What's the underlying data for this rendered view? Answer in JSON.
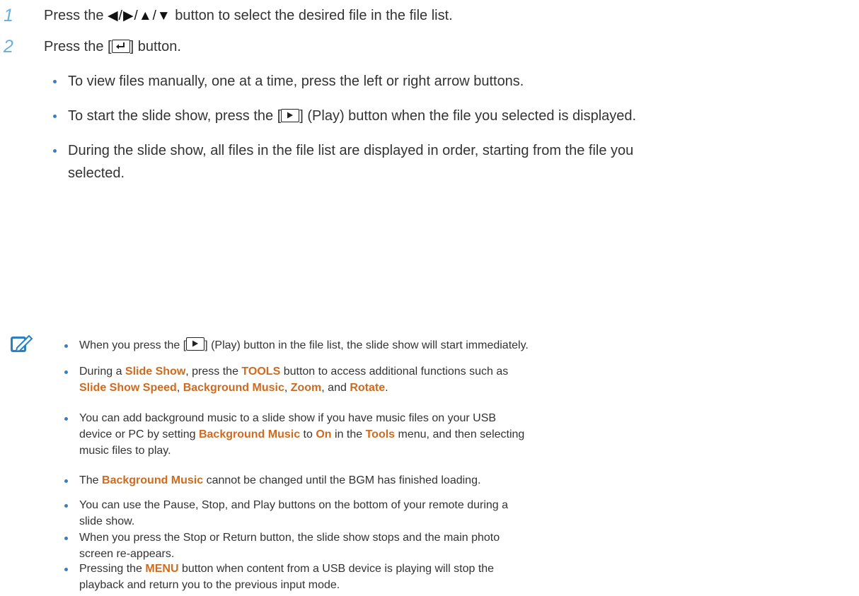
{
  "steps": [
    {
      "num": "1",
      "a": "Press the ",
      "arrows": "◀/▶/▲/▼",
      "b": " button to select the desired file in the file list."
    },
    {
      "num": "2",
      "a": "Press the [",
      "b": "] button."
    }
  ],
  "bullets": [
    "To view files manually, one at a time, press the left or right arrow buttons.",
    {
      "a": "To start the slide show, press the [",
      "b": "] (Play) button when the file you selected is displayed."
    },
    {
      "l1": "During the slide show, all files in the file list are displayed in order, starting from the file you",
      "l2": "selected."
    }
  ],
  "notes": {
    "n1": {
      "a": "When you press the [",
      "b": "] (Play) button in the file list, the slide show will start immediately."
    },
    "n2": {
      "a": "During a ",
      "h1": "Slide Show",
      "b": ", press the ",
      "h2": "TOOLS",
      "c": " button to access additional functions such as",
      "h3": "Slide Show Speed",
      "d": ", ",
      "h4": "Background Music",
      "e": ", ",
      "h5": "Zoom",
      "f": ", and ",
      "h6": "Rotate",
      "g": "."
    },
    "n3": {
      "l1": "You can add background music to a slide show if you have music files on your USB",
      "a": "device or PC by setting ",
      "h1": "Background Music",
      "b": " to ",
      "h2": "On",
      "c": " in the ",
      "h3": "Tools",
      "d": " menu, and then selecting",
      "l3": "music files to play."
    },
    "n4": {
      "a": "The ",
      "h1": "Background Music",
      "b": " cannot be changed until the BGM has finished loading."
    },
    "n5": {
      "l1": "You can use the Pause, Stop, and Play buttons on the bottom of your remote during a",
      "l2": "slide show."
    },
    "n6": {
      "l1": "When you press the Stop or Return button, the slide show stops and the main photo",
      "l2": "screen re-appears."
    },
    "n7": {
      "a": "Pressing the ",
      "h1": "MENU",
      "b": " button when content from a USB device is playing will stop the",
      "l2": "playback and return you to the previous input mode."
    }
  },
  "colors": {
    "accent": "#cf6a1e",
    "step_number": "#6aaedc",
    "bullet": "#3a7fc0"
  },
  "icons": {
    "note": "note-pencil-icon",
    "enter": "enter-key-icon",
    "play": "play-key-icon"
  }
}
